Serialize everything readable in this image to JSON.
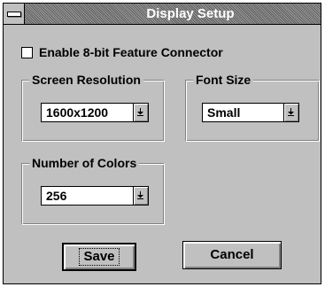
{
  "window": {
    "title": "Display Setup"
  },
  "checkbox": {
    "label": "Enable 8-bit Feature Connector",
    "checked": false
  },
  "screen_resolution": {
    "label": "Screen Resolution",
    "value": "1600x1200"
  },
  "font_size": {
    "label": "Font Size",
    "value": "Small"
  },
  "number_of_colors": {
    "label": "Number of Colors",
    "value": "256"
  },
  "buttons": {
    "save": "Save",
    "cancel": "Cancel"
  },
  "icons": {
    "system_menu": "system-menu-icon",
    "dropdown": "dropdown-arrow-icon"
  }
}
